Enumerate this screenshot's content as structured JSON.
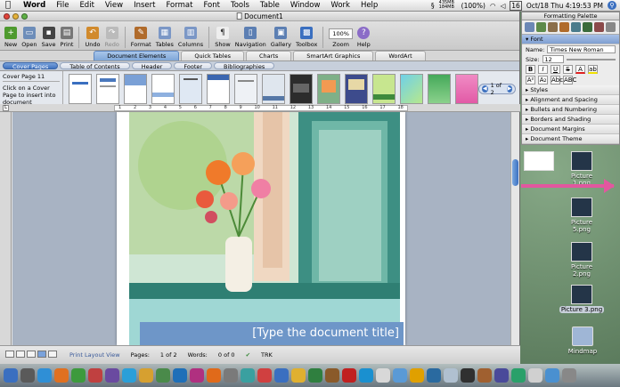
{
  "menubar": {
    "app": "Word",
    "items": [
      "File",
      "Edit",
      "View",
      "Insert",
      "Format",
      "Font",
      "Tools",
      "Table",
      "Window",
      "Work",
      "Help"
    ],
    "battery": "(100%)",
    "datetime": "Oct/18 Thu 4:19:53 PM",
    "mem": "435MB 184MB",
    "date_badge": "16"
  },
  "window": {
    "title": "Document1"
  },
  "toolbar": {
    "new": "New",
    "open": "Open",
    "save": "Save",
    "print": "Print",
    "undo": "Undo",
    "redo": "Redo",
    "format": "Format",
    "tables": "Tables",
    "columns": "Columns",
    "show": "Show",
    "navigation": "Navigation",
    "gallery": "Gallery",
    "toolbox": "Toolbox",
    "zoom_value": "100%",
    "zoom": "Zoom",
    "help": "Help"
  },
  "ribbon": {
    "tabs": [
      "Document Elements",
      "Quick Tables",
      "Charts",
      "SmartArt Graphics",
      "WordArt"
    ],
    "active": 0,
    "subtabs": [
      "Cover Pages",
      "Table of Contents",
      "Header",
      "Footer",
      "Bibliographies"
    ],
    "active_sub": 0,
    "gallery_heading": "Cover Page 11",
    "gallery_hint": "Click on a Cover Page to insert into document",
    "pager": "1 of 2"
  },
  "ruler": {
    "ticks": [
      "1",
      "2",
      "3",
      "4",
      "5",
      "6",
      "7",
      "8",
      "9",
      "10",
      "11",
      "12",
      "13",
      "14",
      "15",
      "16",
      "17",
      "18"
    ]
  },
  "document": {
    "title_placeholder": "[Type the document title]"
  },
  "statusbar": {
    "view": "Print Layout View",
    "pages_label": "Pages:",
    "pages_value": "1 of 2",
    "words_label": "Words:",
    "words_value": "0 of 0",
    "trk": "TRK"
  },
  "palette": {
    "title": "Formatting Palette",
    "font_section": "Font",
    "name_label": "Name:",
    "name_value": "Times New Roman",
    "size_label": "Size:",
    "size_value": "12",
    "sections": [
      "Styles",
      "Alignment and Spacing",
      "Bullets and Numbering",
      "Borders and Shading",
      "Document Margins",
      "Document Theme"
    ],
    "font_color": "#e02020",
    "highlight": "#f0e000"
  },
  "desktop": {
    "icons": [
      "Picture 1.png",
      "Picture 5.png",
      "Picture 2.png",
      "Picture 3.png",
      "Mindmap"
    ]
  },
  "colors": {
    "accent": "#3f72c0",
    "title_band": "#6e96c8"
  }
}
